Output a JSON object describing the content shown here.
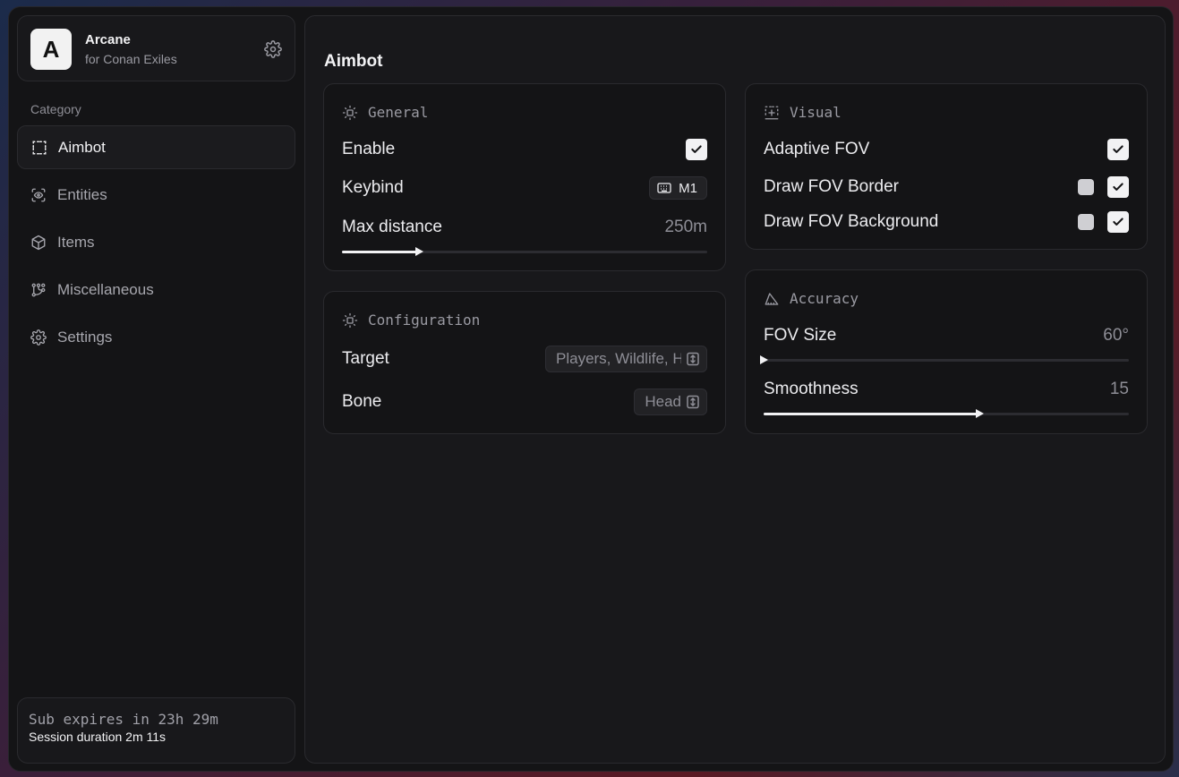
{
  "brand": {
    "logo_letter": "A",
    "name": "Arcane",
    "subtitle": "for Conan Exiles"
  },
  "sidebar": {
    "category_label": "Category",
    "items": [
      {
        "label": "Aimbot",
        "icon": "dashed-square-icon",
        "active": true
      },
      {
        "label": "Entities",
        "icon": "eye-scan-icon",
        "active": false
      },
      {
        "label": "Items",
        "icon": "box-icon",
        "active": false
      },
      {
        "label": "Miscellaneous",
        "icon": "nodes-icon",
        "active": false
      },
      {
        "label": "Settings",
        "icon": "gear-icon",
        "active": false
      }
    ]
  },
  "footer": {
    "sub_expires": "Sub expires in 23h 29m",
    "session_duration": "Session duration  2m 11s"
  },
  "main": {
    "title": "Aimbot",
    "general": {
      "title": "General",
      "enable_label": "Enable",
      "enable_checked": true,
      "keybind_label": "Keybind",
      "keybind_value": "M1",
      "max_distance_label": "Max distance",
      "max_distance_value": "250m",
      "max_distance_fraction": 0.21
    },
    "configuration": {
      "title": "Configuration",
      "target_label": "Target",
      "target_value": "Players, Wildlife, Hu...",
      "bone_label": "Bone",
      "bone_value": "Head"
    },
    "visual": {
      "title": "Visual",
      "adaptive_fov_label": "Adaptive FOV",
      "adaptive_fov_checked": true,
      "draw_fov_border_label": "Draw FOV Border",
      "draw_fov_border_checked": true,
      "draw_fov_background_label": "Draw FOV Background",
      "draw_fov_background_checked": true,
      "swatch_color": "#cfcfd3"
    },
    "accuracy": {
      "title": "Accuracy",
      "fov_size_label": "FOV Size",
      "fov_size_value": "60°",
      "fov_size_fraction": 0.0,
      "smoothness_label": "Smoothness",
      "smoothness_value": "15",
      "smoothness_fraction": 0.59
    }
  },
  "colors": {
    "accent": "#f2f2f4",
    "panel": "#18181b",
    "window": "#141416"
  }
}
